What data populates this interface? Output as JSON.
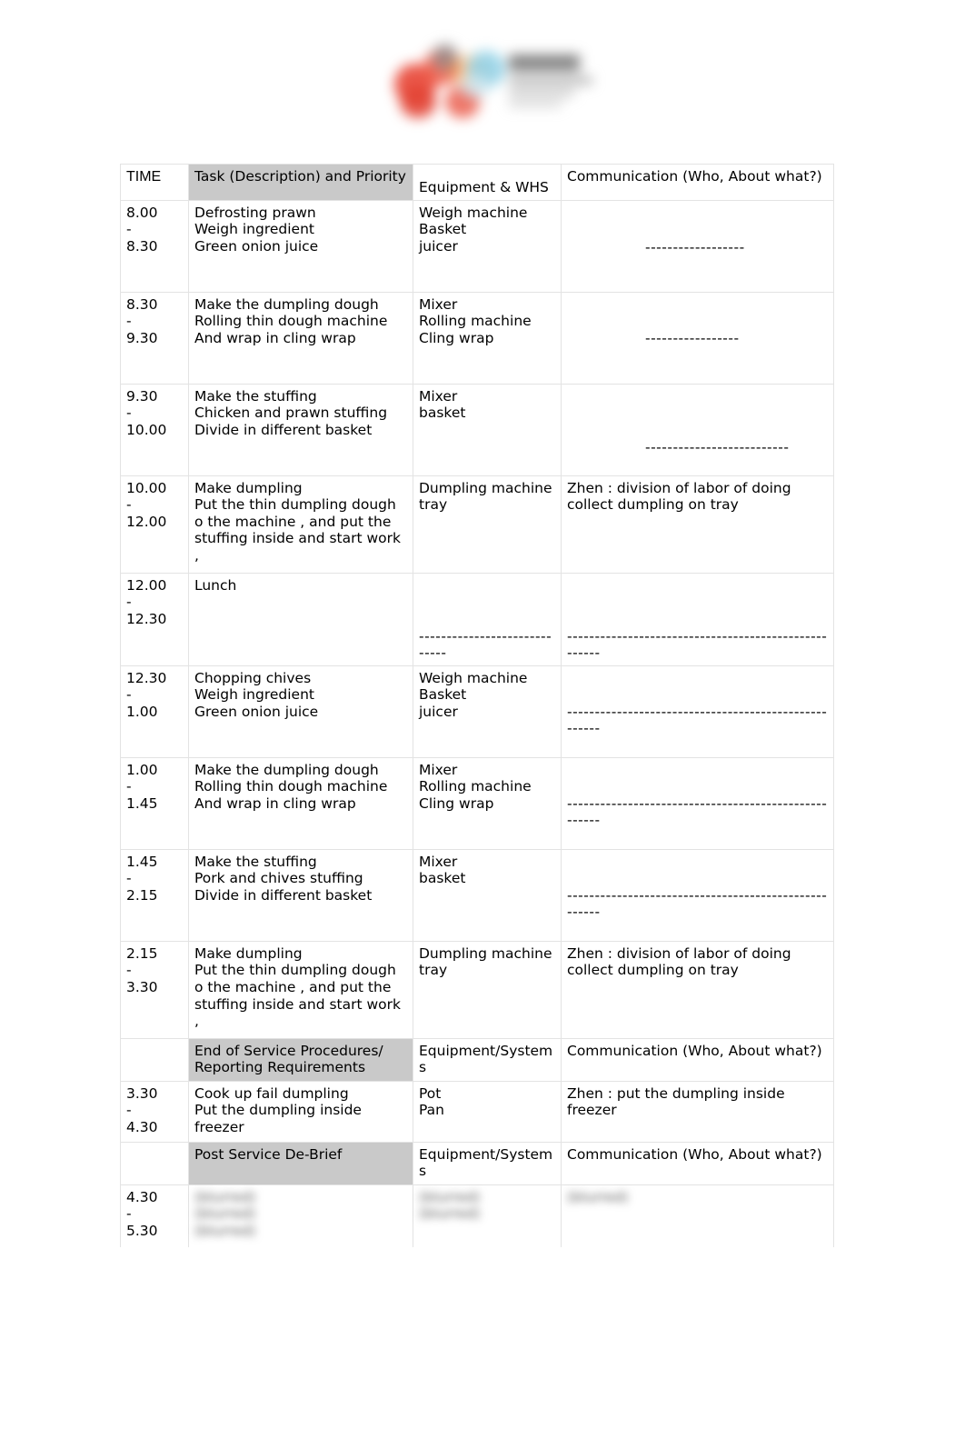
{
  "document": {
    "type": "kitchen-service-plan-table",
    "logo": {
      "alt": "blurred company logo",
      "colors": [
        "#e8493a",
        "#ef5b46",
        "#8ed0e6",
        "#f0a44f",
        "#8d8d8d"
      ]
    }
  },
  "table": {
    "headers": {
      "time": "TIME",
      "task": "Task (Description) and Priority",
      "equipment": "Equipment & WHS",
      "communication": "Communication (Who, About what?)"
    },
    "section_headers": {
      "end_of_service": {
        "task": "End of Service Procedures/ Reporting Requirements",
        "equipment": "Equipment/Systems",
        "communication": "Communication (Who, About what?)"
      },
      "post_service": {
        "task": "Post Service De-Brief",
        "equipment": "Equipment/Systems",
        "communication": "Communication (Who, About what?)"
      }
    },
    "rows": [
      {
        "time_start": "8.00",
        "time_dash": "-",
        "time_end": "8.30",
        "task": [
          "Defrosting prawn",
          "Weigh ingredient",
          "Green onion juice"
        ],
        "equipment": [
          "Weigh machine",
          "Basket",
          "juicer"
        ],
        "communication": "------------------"
      },
      {
        "time_start": "8.30",
        "time_dash": "-",
        "time_end": "9.30",
        "task": [
          "Make the dumpling dough",
          "Rolling thin dough machine",
          "And wrap in cling wrap"
        ],
        "equipment": [
          "Mixer",
          "Rolling machine",
          "Cling wrap"
        ],
        "communication": "-----------------"
      },
      {
        "time_start": "9.30",
        "time_dash": "-",
        "time_end": "10.00",
        "task": [
          "Make the stuffing",
          "Chicken and prawn stuffing",
          "Divide in different basket"
        ],
        "equipment": [
          "Mixer",
          "basket"
        ],
        "communication": "--------------------------"
      },
      {
        "time_start": "10.00",
        "time_dash": "-",
        "time_end": "12.00",
        "task": [
          "Make dumpling",
          "Put the thin dumpling dough o the machine , and put the stuffing inside and start work",
          ","
        ],
        "equipment": [
          "Dumpling machine",
          "tray"
        ],
        "communication": "Zhen : division of labor of doing collect dumpling on tray"
      },
      {
        "time_start": "12.00",
        "time_dash": "-",
        "time_end": "12.30",
        "task": [
          "Lunch"
        ],
        "equipment": [
          "-----------------------------"
        ],
        "communication": "-----------------------------------------------------"
      },
      {
        "time_start": "12.30",
        "time_dash": "-",
        "time_end": "1.00",
        "task": [
          "Chopping chives",
          "Weigh ingredient",
          "Green onion juice"
        ],
        "equipment": [
          "Weigh machine",
          "Basket",
          "juicer"
        ],
        "communication": "-----------------------------------------------------"
      },
      {
        "time_start": "1.00",
        "time_dash": "-",
        "time_end": "1.45",
        "task": [
          "Make the dumpling dough",
          "Rolling thin dough machine",
          "And wrap in cling wrap"
        ],
        "equipment": [
          "Mixer",
          "Rolling machine",
          "Cling wrap"
        ],
        "communication": "-----------------------------------------------------"
      },
      {
        "time_start": "1.45",
        "time_dash": "-",
        "time_end": "2.15",
        "task": [
          "Make the stuffing",
          "Pork and chives stuffing",
          "Divide in different basket"
        ],
        "equipment": [
          "Mixer",
          "basket"
        ],
        "communication": "-----------------------------------------------------"
      },
      {
        "time_start": "2.15",
        "time_dash": "-",
        "time_end": "3.30",
        "task": [
          "Make dumpling",
          "Put the thin dumpling dough o the machine , and put the stuffing inside and start work",
          ","
        ],
        "equipment": [
          "Dumpling machine",
          "tray"
        ],
        "communication": "Zhen : division of labor of doing collect dumpling on tray"
      },
      {
        "time_start": "3.30",
        "time_dash": "-",
        "time_end": "4.30",
        "task": [
          "Cook up fail dumpling",
          "Put the dumpling inside freezer"
        ],
        "equipment": [
          "Pot",
          "Pan"
        ],
        "communication": "Zhen : put the dumpling inside freezer"
      },
      {
        "time_start": "4.30",
        "time_dash": "-",
        "time_end": "5.30",
        "task": [
          "(blurred)",
          "(blurred)",
          "(blurred)"
        ],
        "equipment": [
          "(blurred)",
          "(blurred)"
        ],
        "communication": "(blurred)"
      }
    ]
  }
}
